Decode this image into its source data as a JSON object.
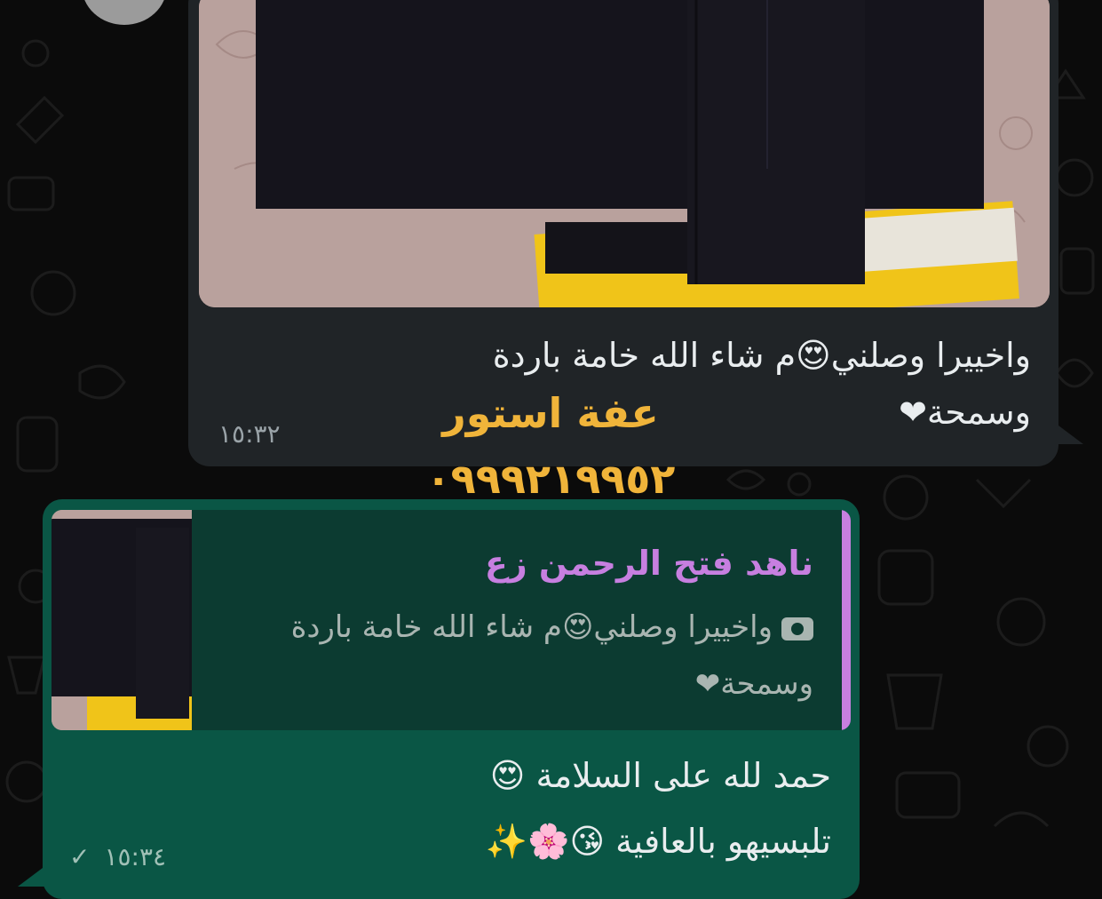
{
  "incoming_message": {
    "text_line1": "واخييرا وصلني😍م شاء الله خامة باردة",
    "text_line2": "وسمحة❤",
    "time": "١٥:٣٢"
  },
  "watermark": {
    "store_name": "عفة استور",
    "phone": "٠٩٩٩٢١٩٩٥٢"
  },
  "outgoing_message": {
    "quoted": {
      "sender": "ناهد فتح الرحمن زع",
      "icon": "camera-icon",
      "text_line1": "واخييرا وصلني😍م شاء الله خامة باردة",
      "text_line2": "وسمحة❤"
    },
    "text_line1": "حمد لله على السلامة 😍",
    "text_line2": "تلبسيهو بالعافية 😘🌸✨",
    "time": "١٥:٣٤",
    "status_icon": "check-icon"
  },
  "colors": {
    "incoming_bubble": "#202427",
    "outgoing_bubble": "#0a5645",
    "quote_accent": "#c77fe0",
    "watermark": "#f0b43a"
  }
}
